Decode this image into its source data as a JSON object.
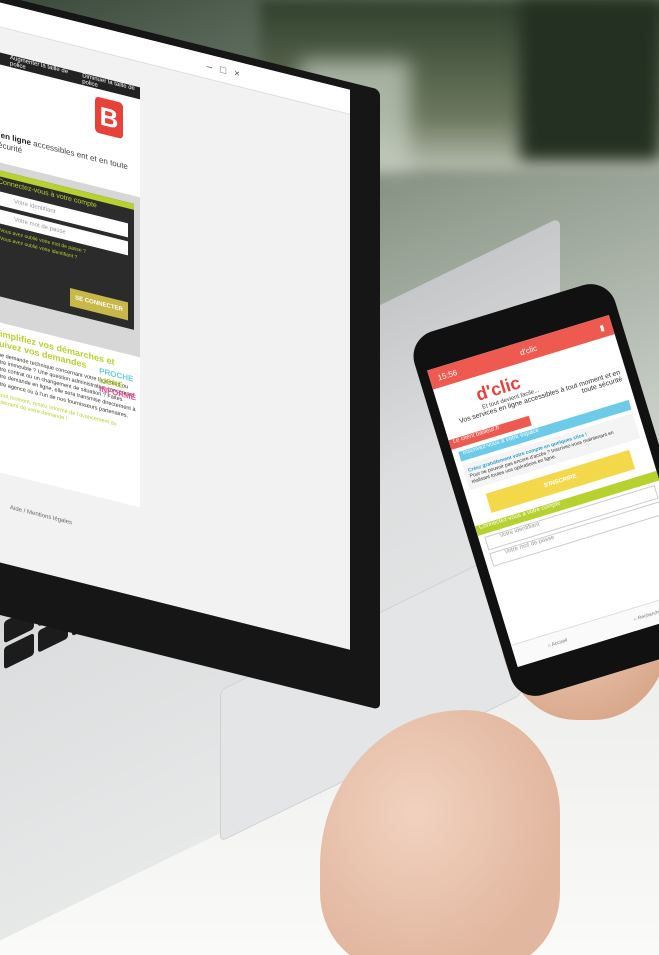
{
  "laptop": {
    "window_controls": [
      "–",
      "□",
      "×"
    ],
    "accessibility_bar": [
      "Augmenter la taille de police",
      "Diminuer la taille de police"
    ],
    "tagline_bold": "s en ligne",
    "tagline_rest": "accessibles\nent et en toute sécurité",
    "login": {
      "title": "Connectez-vous à votre compte",
      "username_placeholder": "Votre identifiant",
      "password_placeholder": "Votre mot de passe",
      "forgot_password": "Vous avez oublié votre mot de passe ?",
      "forgot_id": "Vous avez oublié votre identifiant ?",
      "submit": "SE CONNECTER"
    },
    "promo": {
      "title": "Simplifiez vos démarches et suivez vos demandes",
      "text": "Une demande technique concernant votre logement ou votre immeuble ? Une question administrative concernant votre contrat ou un changement de situation ? Faites votre demande en ligne, elle sera transmise directement à votre agence ou à l'un de nos fournisseurs partenaires.",
      "words": [
        "PROCHE",
        "LIBRE",
        "INFORMÉ"
      ],
      "footer_note": "À tout moment, restez informé de l'avancement du traitement de votre demande !"
    },
    "footer_links": [
      "Aide",
      "Mentions légales"
    ]
  },
  "phone": {
    "time": "15:56",
    "header_title": "d'clic",
    "logo": "d'clic",
    "logo_tagline": "Et tout devient facile...",
    "intro": "Vos services en ligne accessibles à tout moment et en toute sécurité",
    "ribbon": "Le client bailleur.fr",
    "signup_title": "Inscrivez-vous à votre espace",
    "signup_card_title": "Créez gratuitement votre compte en quelques clics !",
    "signup_card_text": "Pour ne pouvoir pas encore d'accès ? Inscrivez-vous maintenant en réalisant toutes vos opérations en ligne.",
    "signup_button": "S'INSCRIRE",
    "login_title": "Connectez-vous à votre compte",
    "username_placeholder": "Votre identifiant",
    "password_placeholder": "Votre mot de passe",
    "nav": [
      "Accueil",
      "Rechercher"
    ]
  }
}
